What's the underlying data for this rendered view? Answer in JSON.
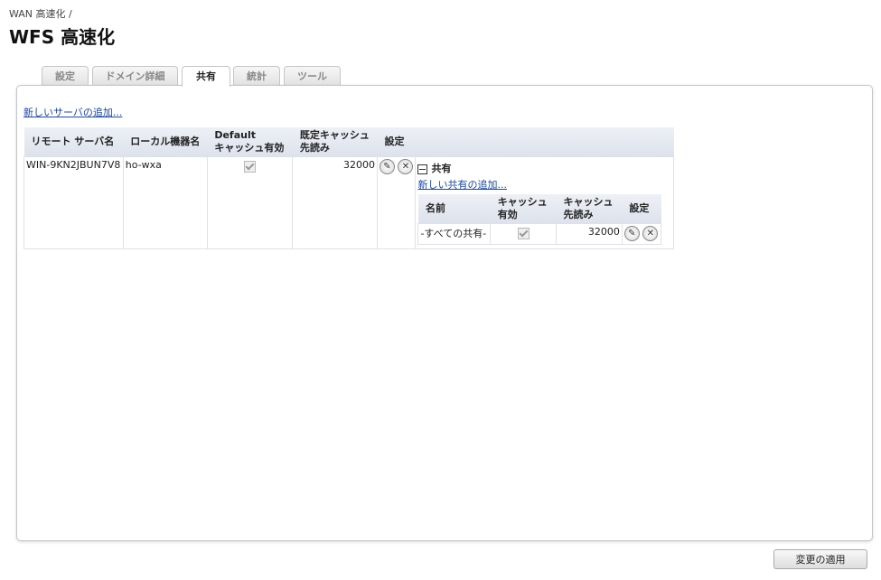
{
  "header": {
    "breadcrumb": "WAN 高速化 /",
    "title": "WFS 高速化"
  },
  "tabs": [
    {
      "label": "設定"
    },
    {
      "label": "ドメイン詳細"
    },
    {
      "label": "共有"
    },
    {
      "label": "統計"
    },
    {
      "label": "ツール"
    }
  ],
  "main": {
    "add_server_link": "新しいサーバの追加...",
    "columns": {
      "remote": "リモート サーバ名",
      "local": "ローカル機器名",
      "default1": "Default",
      "default2": "キャッシュ有効",
      "prefetch1": "既定キャッシュ",
      "prefetch2": "先読み",
      "settings": "設定"
    },
    "row": {
      "remote": "WIN-9KN2JBUN7V8",
      "local": "ho-wxa",
      "prefetch": "32000"
    },
    "shares": {
      "title": "共有",
      "add_share_link": "新しい共有の追加...",
      "columns": {
        "name": "名前",
        "cache1": "キャッシュ",
        "cache2": "有効",
        "prefetch1": "キャッシュ",
        "prefetch2": "先読み",
        "settings": "設定"
      },
      "row": {
        "name": "-すべての共有-",
        "prefetch": "32000"
      }
    }
  },
  "footer": {
    "apply_label": "変更の適用"
  }
}
